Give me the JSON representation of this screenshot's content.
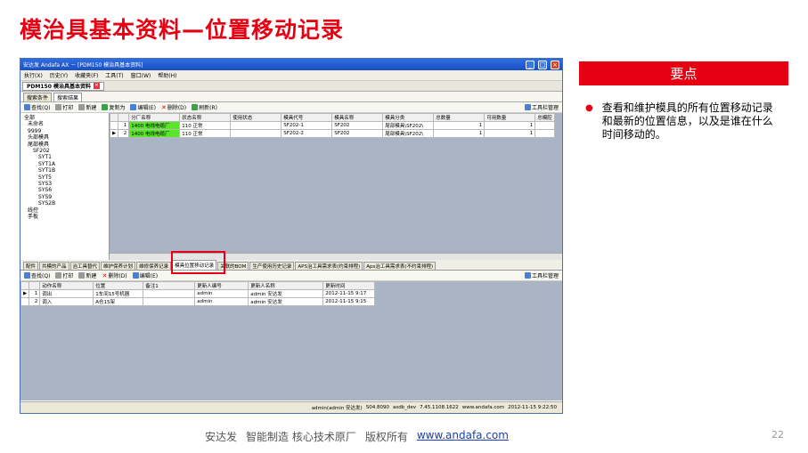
{
  "slide": {
    "title": "模治具基本资料—位置移动记录",
    "keypoint_header": "要点",
    "bullet": "查看和维护模具的所有位置移动记录和最新的位置信息，以及是谁在什么时间移动的。",
    "footer_company": "安达发",
    "footer_tagline": "智能制造 核心技术原厂",
    "footer_rights": "版权所有",
    "footer_link": "www.andafa.com",
    "page_number": "22"
  },
  "window": {
    "title": "安达发 Andafa AX － [PDM150 模治具基本资料]",
    "menus": [
      "执行(X)",
      "历史(Y)",
      "收藏夹(F)",
      "工具(T)",
      "窗口(W)",
      "帮助(H)"
    ],
    "doc_tab": "PDM150 模治具基本资料",
    "sub_tabs": [
      "搜索条件",
      "搜索结果"
    ],
    "toolbar": [
      "查找(Q)",
      "打印",
      "新建",
      "复制为",
      "编辑(E)",
      "删除(D)",
      "刷新(R)"
    ],
    "toolbar_right": "工具栏管理",
    "toolbar2": [
      "查找(Q)",
      "打印",
      "新建",
      "删除(D)",
      "编辑(E)"
    ]
  },
  "tree": [
    "全部",
    "未命名",
    "9999",
    "头部模具",
    "尾部模具",
    "SF202",
    "SYT1",
    "SYT1A",
    "SYT1B",
    "SYT5",
    "SYS3",
    "SYS6",
    "SYS9",
    "SYS2B",
    "线控",
    "手板"
  ],
  "upper_grid": {
    "columns": [
      "",
      "",
      "分厂名称",
      "状态名称",
      "使用状态",
      "模具代号",
      "模具名称",
      "模具分类",
      "总数量",
      "可用数量",
      "总模腔"
    ],
    "rows": [
      [
        "",
        "1",
        "1400 电线电缆厂",
        "110 正常",
        "",
        "SF202-1",
        "SF202",
        "尾部模具\\SF202\\",
        "1",
        "1",
        ""
      ],
      [
        "▶",
        "2",
        "1400 电线电缆厂",
        "110 正常",
        "",
        "SF202-2",
        "SF202",
        "尾部模具\\SF202\\",
        "1",
        "1",
        ""
      ]
    ]
  },
  "bottom_tabs": [
    "配件",
    "共模的产品",
    "治工具替代",
    "维护保养计划",
    "维修保养记录",
    "模具位置移动记录",
    "关联的BOM",
    "生产使用历史记录",
    "APS治工具需求表(约束排程)",
    "Aps治工具需求表(不约束排程)"
  ],
  "lower_grid": {
    "columns": [
      "",
      "",
      "动作名称",
      "位置",
      "备注1",
      "更新人编号",
      "更新人名称",
      "更新时间"
    ],
    "rows": [
      [
        "▶",
        "1",
        "调出",
        "1车间15号机器",
        "",
        "admin",
        "admin 安达发",
        "2012-11-15 9:17"
      ],
      [
        "",
        "2",
        "调入",
        "A仓15架",
        "",
        "admin",
        "admin 安达发",
        "2012-11-15 9:15"
      ]
    ]
  },
  "statusbar": [
    "admin(admin 安达发)",
    "S04.8090",
    "asdb_dev",
    "7.45.1108.1622",
    "www.andafa.com",
    "2012-11-15 9:22:50"
  ],
  "colors": {
    "accent": "#e60012",
    "highlight_cell": "#59e62a"
  }
}
